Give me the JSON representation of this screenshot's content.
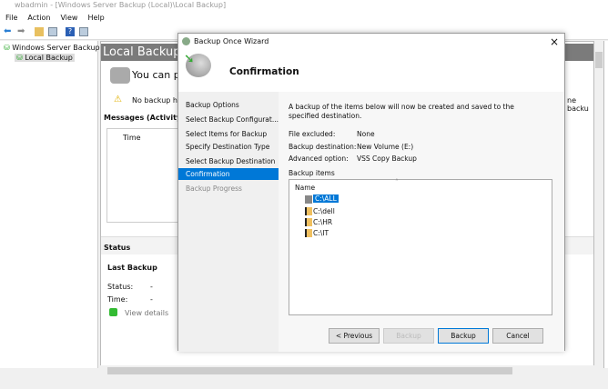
{
  "window": {
    "title": "wbadmin - [Windows Server Backup (Local)\\Local Backup]"
  },
  "menu": [
    "File",
    "Action",
    "View",
    "Help"
  ],
  "tree": {
    "root": "Windows Server Backup (L",
    "child": "Local Backup"
  },
  "main": {
    "header": "Local Backup",
    "intro": "You can per",
    "warning": "No backup has",
    "warning_right": "ne backu",
    "messages_header": "Messages (Activity fro",
    "time_col": "Time",
    "status_header": "Status",
    "last_backup": "Last Backup",
    "status_label": "Status:",
    "status_value": "-",
    "time_label": "Time:",
    "time_value": "-",
    "view_details": "View details"
  },
  "dialog": {
    "title": "Backup Once Wizard",
    "heading": "Confirmation",
    "nav": [
      "Backup Options",
      "Select Backup Configurat...",
      "Select Items for Backup",
      "Specify Destination Type",
      "Select Backup Destination",
      "Confirmation",
      "Backup Progress"
    ],
    "description": "A backup of the items below will now be created and saved to the specified destination.",
    "fields": [
      {
        "label": "File excluded:",
        "value": "None"
      },
      {
        "label": "Backup destination:",
        "value": "New Volume (E:)"
      },
      {
        "label": "Advanced option:",
        "value": "VSS Copy Backup"
      }
    ],
    "items_label": "Backup items",
    "name_col": "Name",
    "items": [
      "C:\\ALL",
      "C:\\dell",
      "C:\\HR",
      "C:\\IT"
    ],
    "buttons": {
      "previous": "< Previous",
      "next": "Backup",
      "backup": "Backup",
      "cancel": "Cancel"
    },
    "close": "×"
  },
  "colors": {
    "selection": "#0078d7",
    "header": "#7b7b7b"
  }
}
